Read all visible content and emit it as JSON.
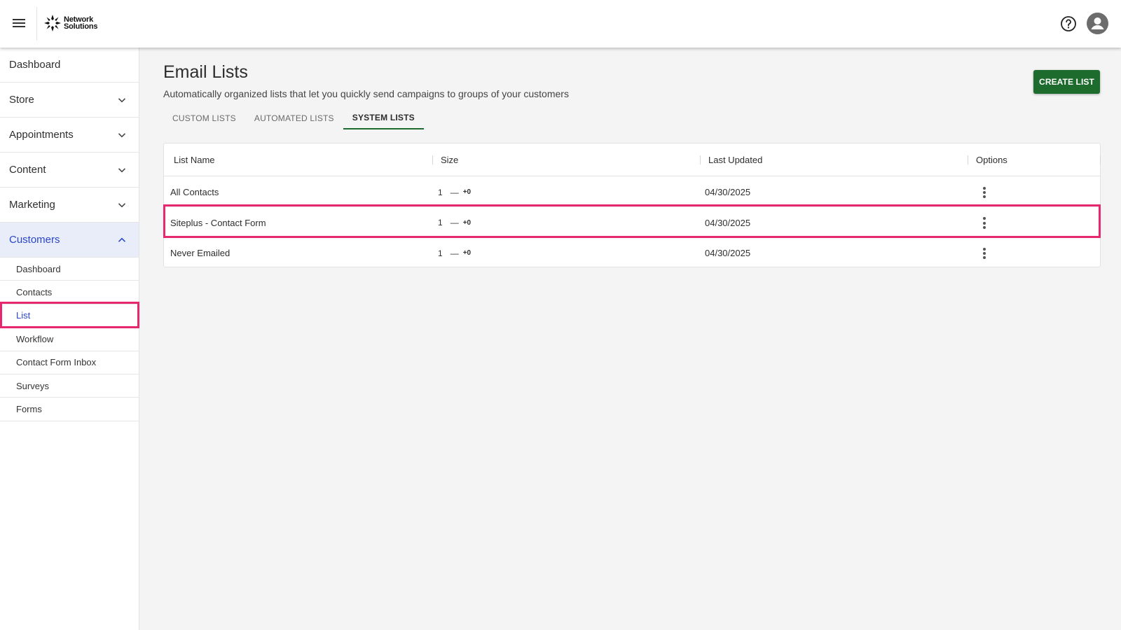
{
  "brand": {
    "line1": "Network",
    "line2": "Solutions"
  },
  "sidebar": {
    "items": [
      {
        "label": "Dashboard"
      },
      {
        "label": "Store"
      },
      {
        "label": "Appointments"
      },
      {
        "label": "Content"
      },
      {
        "label": "Marketing"
      },
      {
        "label": "Customers"
      }
    ],
    "customers_subitems": [
      {
        "label": "Dashboard"
      },
      {
        "label": "Contacts"
      },
      {
        "label": "List"
      },
      {
        "label": "Workflow"
      },
      {
        "label": "Contact Form Inbox"
      },
      {
        "label": "Surveys"
      },
      {
        "label": "Forms"
      }
    ]
  },
  "page": {
    "title": "Email Lists",
    "subtitle": "Automatically organized lists that let you quickly send campaigns to groups of your customers",
    "create_button": "CREATE LIST"
  },
  "tabs": [
    {
      "label": "CUSTOM LISTS"
    },
    {
      "label": "AUTOMATED LISTS"
    },
    {
      "label": "SYSTEM LISTS"
    }
  ],
  "table": {
    "headers": {
      "list_name": "List Name",
      "size": "Size",
      "last_updated": "Last Updated",
      "options": "Options"
    },
    "rows": [
      {
        "name": "All Contacts",
        "size": "1",
        "dash": "—",
        "delta": "+0",
        "last_updated": "04/30/2025"
      },
      {
        "name": "Siteplus - Contact Form",
        "size": "1",
        "dash": "—",
        "delta": "+0",
        "last_updated": "04/30/2025"
      },
      {
        "name": "Never Emailed",
        "size": "1",
        "dash": "—",
        "delta": "+0",
        "last_updated": "04/30/2025"
      }
    ]
  },
  "colors": {
    "accent_green": "#1d6b2d",
    "active_blue": "#2a45c8",
    "highlight_pink": "#e8286e"
  }
}
